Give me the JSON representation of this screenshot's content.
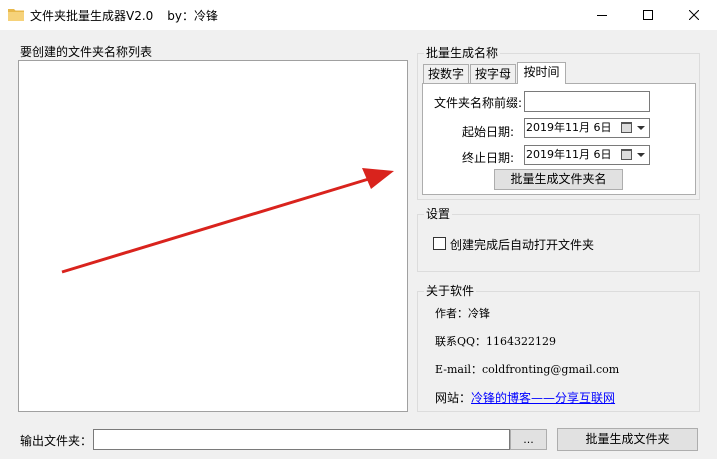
{
  "window": {
    "title": "文件夹批量生成器V2.0",
    "author_tag": "by：冷锋"
  },
  "list_group": {
    "label": "要创建的文件夹名称列表"
  },
  "batch_group": {
    "label": "批量生成名称",
    "tabs": [
      {
        "label": "按数字",
        "active": false
      },
      {
        "label": "按字母",
        "active": false
      },
      {
        "label": "按时间",
        "active": true
      }
    ],
    "prefix_label": "文件夹名称前缀:",
    "prefix_value": "",
    "start_label": "起始日期:",
    "start_value": "2019年11月  6日",
    "end_label": "终止日期:",
    "end_value": "2019年11月  6日",
    "generate_names_button": "批量生成文件夹名"
  },
  "settings_group": {
    "label": "设置",
    "open_after_create_label": "创建完成后自动打开文件夹",
    "open_after_create_checked": false
  },
  "about_group": {
    "label": "关于软件",
    "author": "作者：冷锋",
    "qq": "联系QQ：1164322129",
    "email": "E-mail：coldfronting@gmail.com",
    "site_label": "网站：",
    "site_link": "冷锋的博客——分享互联网"
  },
  "output": {
    "label": "输出文件夹：",
    "value": "",
    "browse_button": "...",
    "create_button": "批量生成文件夹"
  },
  "colors": {
    "arrow": "#d9231d",
    "link": "#0000ff"
  },
  "icons": [
    "folder-icon",
    "minimize-icon",
    "maximize-icon",
    "close-icon",
    "calendar-icon",
    "dropdown-arrow-icon",
    "annotation-arrow"
  ]
}
